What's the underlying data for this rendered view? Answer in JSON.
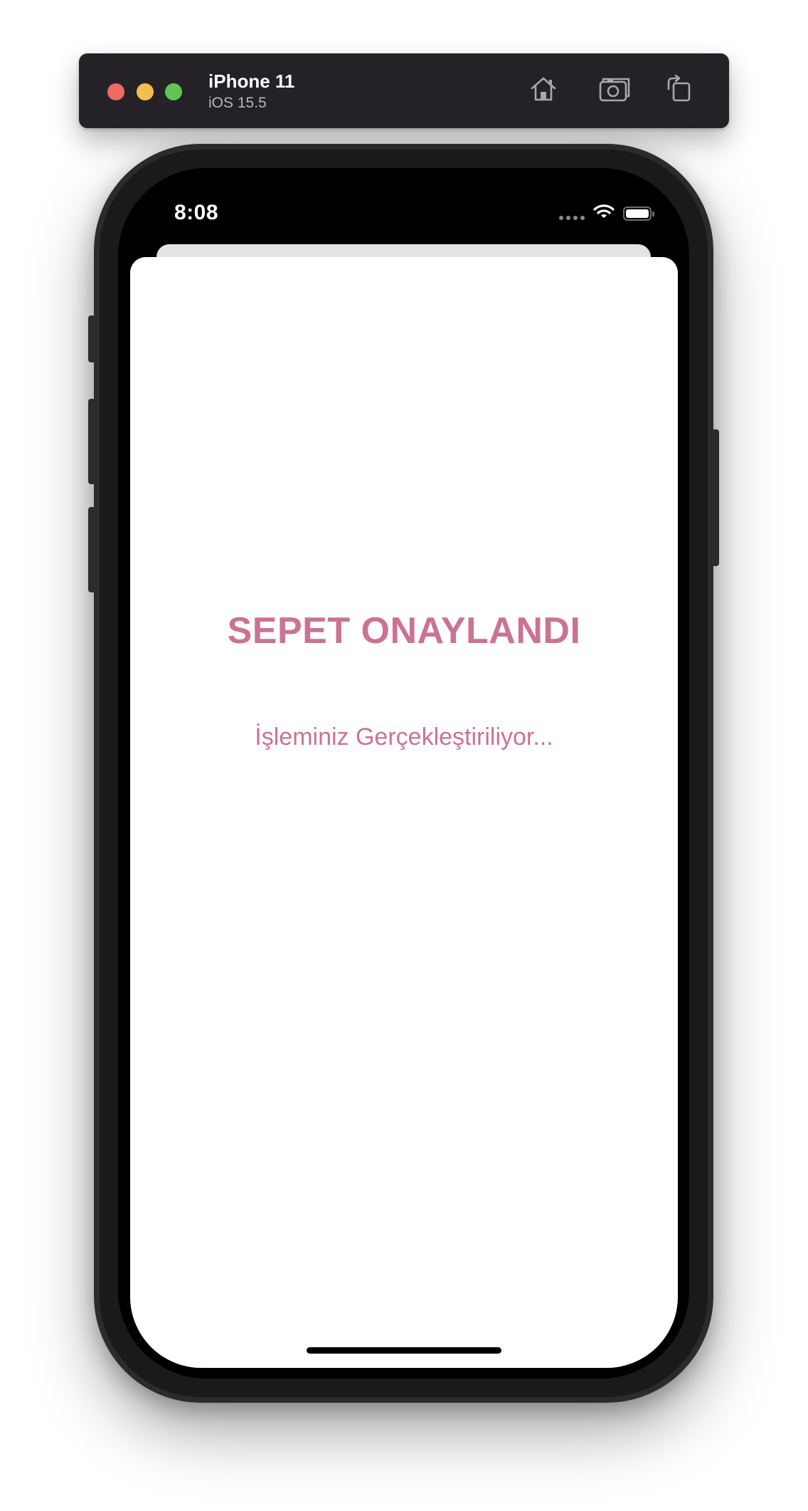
{
  "simulator": {
    "device_name": "iPhone 11",
    "os_version": "iOS 15.5",
    "toolbar": [
      {
        "icon": "home-icon",
        "label": "Home"
      },
      {
        "icon": "screenshot-icon",
        "label": "Save Screen"
      },
      {
        "icon": "rotate-icon",
        "label": "Rotate"
      }
    ]
  },
  "status_bar": {
    "time": "8:08"
  },
  "sheet": {
    "title": "SEPET ONAYLANDI",
    "subtitle": "İşleminiz Gerçekleştiriliyor..."
  },
  "colors": {
    "accent": "#cb7393",
    "sim_bar": "#242127",
    "traffic_close": "#ed6a5e",
    "traffic_minimize": "#f4be4f",
    "traffic_maximize": "#61c454"
  }
}
